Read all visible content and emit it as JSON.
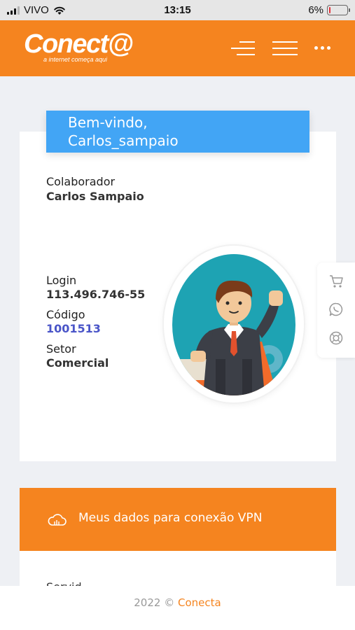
{
  "status_bar": {
    "carrier": "VIVO",
    "time": "13:15",
    "battery_percent": "6%",
    "battery_level": 0.06
  },
  "header": {
    "logo_text": "Conect@",
    "logo_tagline": "a internet começa aqui"
  },
  "profile": {
    "welcome_line1": "Bem-vindo,",
    "welcome_line2": "Carlos_sampaio",
    "role_label": "Colaborador",
    "name": "Carlos Sampaio",
    "login_label": "Login",
    "login": "113.496.746-55",
    "code_label": "Código",
    "code": "1001513",
    "sector_label": "Setor",
    "sector": "Comercial"
  },
  "side_widget": {
    "icons": [
      "cart-icon",
      "whatsapp-icon",
      "support-icon"
    ]
  },
  "vpn": {
    "label": "Meus dados para conexão VPN",
    "icon": "cloud-icon",
    "next_field_partial": "Servid..."
  },
  "footer": {
    "copyright": "2022 ©",
    "brand": "Conecta"
  },
  "colors": {
    "brand_orange": "#f5841f",
    "banner_blue": "#42a5f5",
    "link_blue": "#4a55c8",
    "page_bg": "#eef0f4"
  }
}
